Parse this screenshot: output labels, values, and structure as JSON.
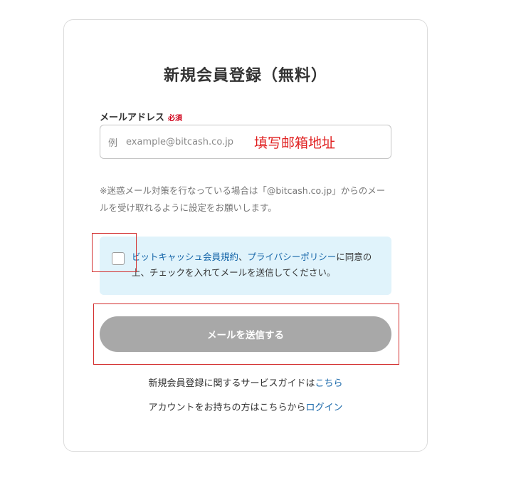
{
  "form": {
    "title": "新規会員登録（無料）",
    "email_label": "メールアドレス",
    "required_badge": "必須",
    "email_prefix": "例",
    "email_placeholder": "example@bitcash.co.jp",
    "email_value": "",
    "notice": "※迷惑メール対策を行なっている場合は「@bitcash.co.jp」からのメールを受け取れるように設定をお願いします。",
    "consent": {
      "checked": false,
      "link_terms": "ビットキャッシュ会員規約",
      "separator": "、",
      "link_privacy": "プライバシーポリシー",
      "text_rest": "に同意の上、チェックを入れてメールを送信してください。"
    },
    "submit_label": "メールを送信する"
  },
  "footer": {
    "guide_text": "新規会員登録に関するサービスガイドは",
    "guide_link": "こちら",
    "login_text": "アカウントをお持ちの方はこちらから",
    "login_link": "ログイン"
  },
  "annotations": {
    "email_hint": "填写邮箱地址"
  },
  "colors": {
    "link": "#1565a8",
    "required": "#d0021b",
    "annotation": "#e02020",
    "consent_bg": "#e0f3fb",
    "button_disabled": "#a8a8a8"
  }
}
